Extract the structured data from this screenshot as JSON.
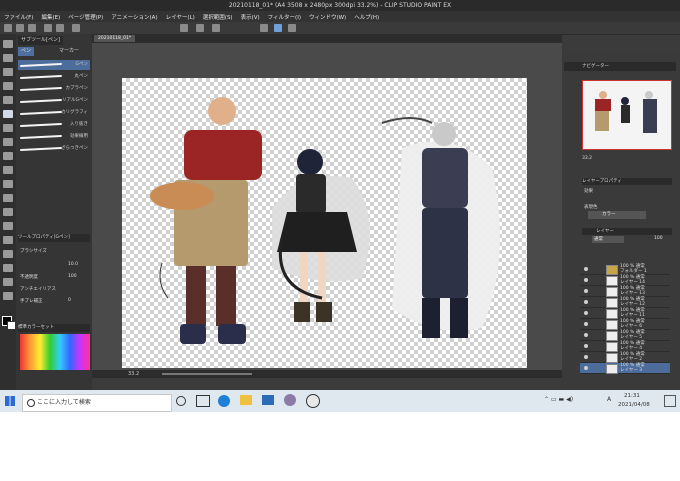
{
  "title": "20210118_01* (A4 3508 x 2480px 300dpi 33.2%) - CLIP STUDIO PAINT EX",
  "menu": [
    "ファイル(F)",
    "編集(E)",
    "ページ管理(P)",
    "アニメーション(A)",
    "レイヤー(L)",
    "選択範囲(S)",
    "表示(V)",
    "フィルター(I)",
    "ウィンドウ(W)",
    "ヘルプ(H)"
  ],
  "subtool": {
    "tabs": [
      "サブツール[ペン]",
      "ペン",
      "マーカー"
    ],
    "brushes": [
      "Gペン",
      "丸ペン",
      "カブラペン",
      "リアルGペン",
      "カリグラフィ",
      "入り抜き",
      "効果線用",
      "ざらつきペン"
    ],
    "props_title": "ツールプロパティ[Gペン]",
    "props": [
      {
        "label": "ブラシサイズ",
        "value": "10.0"
      },
      {
        "label": "不透明度",
        "value": "100"
      },
      {
        "label": "アンチエイリアス",
        "value": ""
      },
      {
        "label": "手ブレ補正",
        "value": "0"
      }
    ],
    "color_set_title": "標準カラーセット"
  },
  "canvas_tab": "20210118_01*",
  "canvas_zoom": "33.2",
  "right": {
    "navigator_tab": "ナビゲーター",
    "zoom_value": "33.2",
    "layer_prop_title": "レイヤープロパティ",
    "effect_label": "効果",
    "expression_label": "表現色",
    "expression_value": "カラー",
    "layer_panel_title": "レイヤー",
    "blend_mode": "通常",
    "opacity": "100",
    "layers": [
      {
        "name": "100 % 通常\nフォルダー 1"
      },
      {
        "name": "100 % 通常\nレイヤー 14"
      },
      {
        "name": "100 % 通常\nレイヤー 13"
      },
      {
        "name": "100 % 通常\nレイヤー 12"
      },
      {
        "name": "100 % 通常\nレイヤー 11"
      },
      {
        "name": "100 % 通常\nレイヤー 6"
      },
      {
        "name": "100 % 通常\nレイヤー 5"
      },
      {
        "name": "100 % 通常\nレイヤー 4"
      },
      {
        "name": "100 % 通常\nレイヤー 2"
      },
      {
        "name": "100 % 通常\nレイヤー 3"
      }
    ]
  },
  "taskbar": {
    "search_placeholder": "ここに入力して検索",
    "ime": "A",
    "time": "21:31",
    "date": "2021/04/08"
  },
  "colors": {
    "accent": "#c33a3a",
    "ui_bg": "#3b3b3b",
    "taskbar": "#dfe7ef"
  }
}
